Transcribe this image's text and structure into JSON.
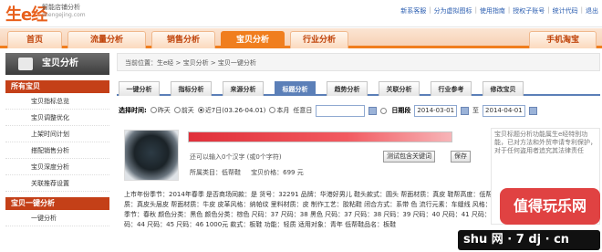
{
  "header": {
    "logo": "生e经",
    "subtitle": "智能店铺分析",
    "domain": "shengejing.com",
    "links": [
      "新系客服",
      "分为虚拟图标",
      "使用指南",
      "授权子账号",
      "统计代码",
      "退出"
    ]
  },
  "nav": {
    "items": [
      "首页",
      "流量分析",
      "销售分析",
      "宝贝分析",
      "行业分析"
    ],
    "active": "宝贝分析",
    "right": "手机淘宝"
  },
  "sidebar": {
    "title": "宝贝分析",
    "section1": "所有宝贝",
    "items1": [
      "宝贝指标总览",
      "宝贝调整优化",
      "上架时间计划",
      "搭配销售分析",
      "宝贝深度分析",
      "关联推荐设置"
    ],
    "section2": "宝贝一键分析",
    "items2": [
      "一键分析"
    ]
  },
  "main": {
    "breadcrumb": "当前位置：生e经 > 宝贝分析 > 宝贝一键分析",
    "tabs": [
      "一键分析",
      "指标分析",
      "来源分析",
      "标题分析",
      "趋势分析",
      "关联分析",
      "行业参考",
      "修改宝贝"
    ],
    "active_tab": "标题分析",
    "filter": {
      "label": "选择时间:",
      "options": [
        "昨天",
        "前天",
        "近7日(03.26-04.01)",
        "本月"
      ],
      "selected": "近7日(03.26-04.01)",
      "any_day_label": "任意日",
      "range_label": "日期段",
      "start_date": "2014-03-01",
      "to": "至",
      "end_date": "2014-04-01"
    },
    "product": {
      "hint": "还可以输入0个汉字 (或0个字符)",
      "test_button": "测试包含关键词",
      "save_button": "保存",
      "category": "所属类目：低帮鞋",
      "price": "宝贝价格：699 元",
      "description": "上市年份季节：2014年春季  是否商场同款：是  货号：32291  品牌：华港好男儿  鞋头款式：圆头  帮面材质：真皮  鞋帮高度：低帮  质：塑胶  鞋面材质：真皮头层皮  帮面材质：牛皮  皮革风格：纳帕纹  里料材质：皮  制作工艺：胶粘鞋  闭合方式：系带  色  流行元素：车缝线  风格：休闲  场合：日常  季节：春秋  颜色分类：黑色  颜色分类：棕色  尺码：37  尺码：38  黑色  尺码：37  尺码：38  尺码：39  尺码：40  尺码：41  尺码：42  尺码：43  尺码：44  尺码：45  尺码：46  1000元  款式：板鞋  功能：轻质  适用对象：青年  低帮鞋品名：板鞋"
    },
    "right_panel": "宝贝标题分析功能属生e经特别功能，已对方法和外贸申请专利保护，对于任何盗用者追究其法律责任"
  },
  "watermark": {
    "brand": "值得玩乐网",
    "site": "shu 网 · 7 dj · cn"
  }
}
